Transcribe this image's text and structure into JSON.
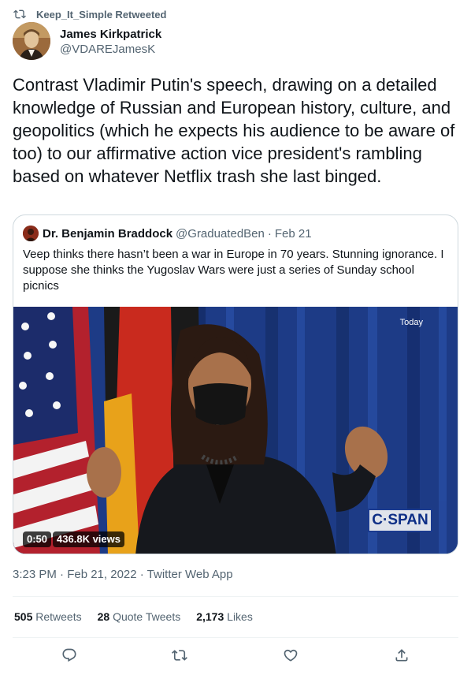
{
  "retweet": {
    "icon": "retweet-icon",
    "text": "Keep_It_Simple Retweeted"
  },
  "author": {
    "name": "James Kirkpatrick",
    "handle": "@VDAREJamesK"
  },
  "tweet": {
    "text": "Contrast Vladimir Putin's speech, drawing on a detailed knowledge of Russian and European history, culture, and geopolitics (which he expects his audience to be aware of too) to our affirmative action vice president's rambling based on whatever Netflix trash she last binged."
  },
  "quote": {
    "name": "Dr. Benjamin Braddock",
    "handle": "@GraduatedBen",
    "separator": "·",
    "date": "Feb 21",
    "text": "Veep thinks there hasn’t been a war in Europe in 70 years. Stunning ignorance. I suppose she thinks the Yugoslav Wars were just a series of Sunday school picnics",
    "video": {
      "watermark": "Today",
      "network": "C·SPAN",
      "duration": "0:50",
      "views": "436.8K views"
    }
  },
  "meta": {
    "text": "3:23 PM · Feb 21, 2022 · Twitter Web App"
  },
  "stats": {
    "retweets_count": "505",
    "retweets_label": "Retweets",
    "quotes_count": "28",
    "quotes_label": "Quote Tweets",
    "likes_count": "2,173",
    "likes_label": "Likes"
  },
  "actions": [
    "reply-icon",
    "retweet-icon",
    "like-icon",
    "share-icon"
  ],
  "colors": {
    "text": "#0f1419",
    "secondary": "#536471",
    "border": "#cfd9de",
    "divider": "#eff3f4"
  }
}
